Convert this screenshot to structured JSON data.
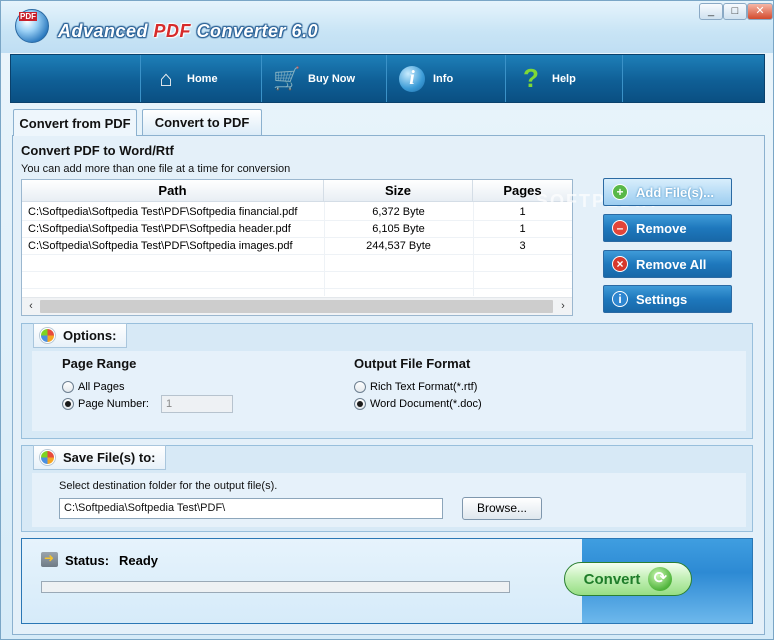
{
  "app": {
    "title_prefix": "Advanced ",
    "title_pdf": "PDF",
    "title_suffix": " Converter 6.0",
    "window_controls": [
      "_",
      "□",
      "✕"
    ]
  },
  "toolbar": {
    "items": [
      {
        "label": "Home",
        "icon": "home-icon"
      },
      {
        "label": "Buy Now",
        "icon": "cart-icon"
      },
      {
        "label": "Info",
        "icon": "info-icon"
      },
      {
        "label": "Help",
        "icon": "help-icon"
      }
    ]
  },
  "tabs": [
    {
      "label": "Convert from PDF",
      "active": true
    },
    {
      "label": "Convert to PDF",
      "active": false
    }
  ],
  "convert_section": {
    "title": "Convert PDF to Word/Rtf",
    "note": "You can add more than one file at a time for conversion"
  },
  "file_table": {
    "columns": [
      "Path",
      "Size",
      "Pages"
    ],
    "rows": [
      {
        "path": "C:\\Softpedia\\Softpedia Test\\PDF\\Softpedia financial.pdf",
        "size": "6,372 Byte",
        "pages": "1"
      },
      {
        "path": "C:\\Softpedia\\Softpedia Test\\PDF\\Softpedia header.pdf",
        "size": "6,105 Byte",
        "pages": "1"
      },
      {
        "path": "C:\\Softpedia\\Softpedia Test\\PDF\\Softpedia images.pdf",
        "size": "244,537 Byte",
        "pages": "3"
      }
    ]
  },
  "side_buttons": {
    "add": "Add File(s)...",
    "remove": "Remove",
    "remove_all": "Remove All",
    "settings": "Settings"
  },
  "options": {
    "label": "Options:",
    "page_range_title": "Page Range",
    "all_pages": "All Pages",
    "page_number": "Page Number:",
    "page_number_value": "1",
    "output_format_title": "Output File Format",
    "rtf": "Rich Text Format(*.rtf)",
    "doc": "Word Document(*.doc)"
  },
  "save": {
    "label": "Save File(s) to:",
    "note": "Select destination folder for the output file(s).",
    "path": "C:\\Softpedia\\Softpedia Test\\PDF\\",
    "browse": "Browse..."
  },
  "status": {
    "label": "Status:",
    "value": "Ready",
    "progress": 0
  },
  "convert_button": "Convert",
  "watermark": "SOFTPEDIA",
  "colors": {
    "toolbar": "#0f5f96",
    "accent_button": "#1e78bd",
    "convert_green": "#1f7d2a"
  }
}
